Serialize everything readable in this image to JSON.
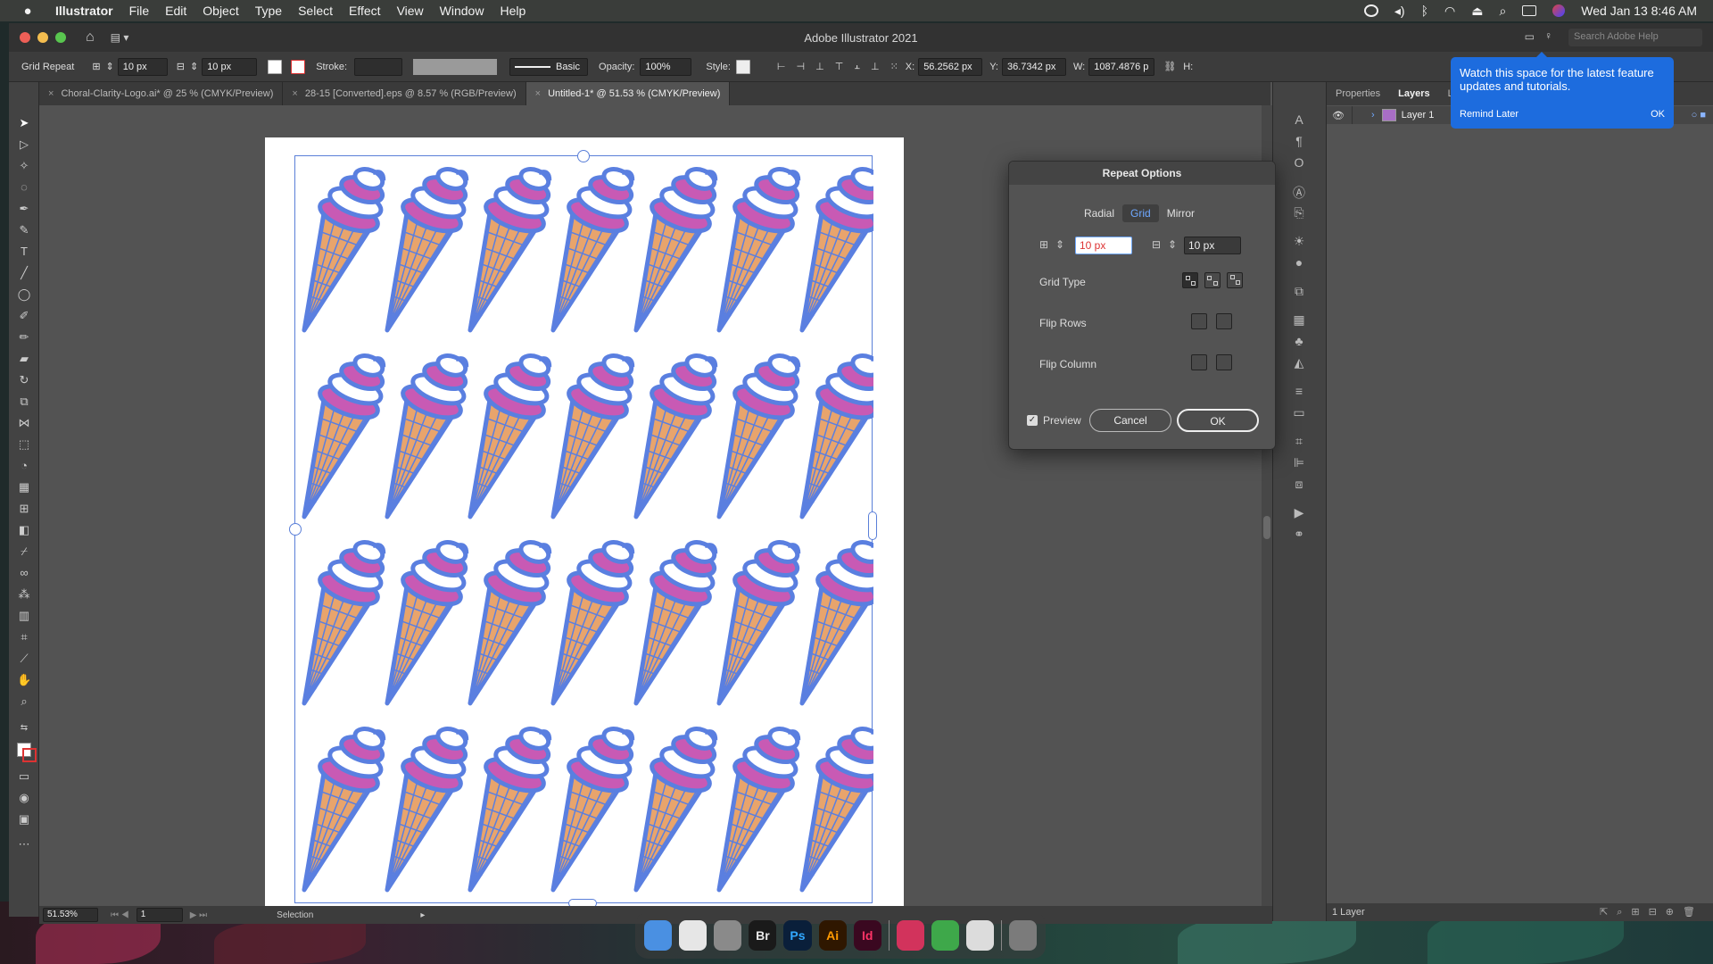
{
  "menubar": {
    "app_name": "Illustrator",
    "menus": [
      "File",
      "Edit",
      "Object",
      "Type",
      "Select",
      "Effect",
      "View",
      "Window",
      "Help"
    ],
    "clock": "Wed Jan 13  8:46 AM"
  },
  "window": {
    "title": "Adobe Illustrator 2021",
    "search_placeholder": "Search Adobe Help"
  },
  "control_bar": {
    "mode_label": "Grid Repeat",
    "h_spacing": "10 px",
    "v_spacing": "10 px",
    "stroke_label": "Stroke:",
    "brush_label": "Basic",
    "opacity_label": "Opacity:",
    "opacity_value": "100%",
    "style_label": "Style:",
    "x_label": "X:",
    "x_value": "56.2562 px",
    "y_label": "Y:",
    "y_value": "36.7342 px",
    "w_label": "W:",
    "w_value": "1087.4876 p",
    "h_label": "H:"
  },
  "tabs": [
    {
      "label": "Choral-Clarity-Logo.ai* @ 25 % (CMYK/Preview)",
      "active": false
    },
    {
      "label": "28-15 [Converted].eps @ 8.57 % (RGB/Preview)",
      "active": false
    },
    {
      "label": "Untitled-1* @ 51.53 % (CMYK/Preview)",
      "active": true
    }
  ],
  "status": {
    "zoom": "51.53%",
    "artboard": "1",
    "tool": "Selection"
  },
  "panel": {
    "tabs": [
      "Properties",
      "Layers",
      "Libr"
    ],
    "active_tab": "Layers",
    "layer_name": "Layer 1",
    "footer": "1 Layer"
  },
  "dialog": {
    "title": "Repeat Options",
    "modes": [
      "Radial",
      "Grid",
      "Mirror"
    ],
    "active_mode": "Grid",
    "h_spacing": "10 px",
    "v_spacing": "10 px",
    "grid_type_label": "Grid Type",
    "flip_rows_label": "Flip Rows",
    "flip_column_label": "Flip Column",
    "preview_label": "Preview",
    "preview_checked": true,
    "cancel_label": "Cancel",
    "ok_label": "OK"
  },
  "tooltip": {
    "message": "Watch this space for the latest feature updates and tutorials.",
    "remind_label": "Remind Later",
    "ok_label": "OK"
  },
  "pattern": {
    "rows": 4,
    "columns": 7
  },
  "dock": {
    "apps": [
      {
        "name": "finder-icon",
        "label": "",
        "color": "#4a90e2"
      },
      {
        "name": "chrome-icon",
        "label": "",
        "color": "#e6e6e6"
      },
      {
        "name": "system-preferences-icon",
        "label": "",
        "color": "#8a8a8a"
      },
      {
        "name": "bridge-icon",
        "label": "Br",
        "color": "#1a1a1a"
      },
      {
        "name": "photoshop-icon",
        "label": "Ps",
        "color": "#0a1f3a"
      },
      {
        "name": "illustrator-icon",
        "label": "Ai",
        "color": "#2f1700"
      },
      {
        "name": "indesign-icon",
        "label": "Id",
        "color": "#3a0820"
      },
      {
        "name": "creative-cloud-icon",
        "label": "",
        "color": "#d2335c"
      },
      {
        "name": "numbers-icon",
        "label": "",
        "color": "#3ea84a"
      },
      {
        "name": "preview-icon",
        "label": "",
        "color": "#dcdcdc"
      },
      {
        "name": "trash-icon",
        "label": "",
        "color": "#7b7b7b"
      }
    ]
  },
  "colors": {
    "accent": "#1d6cde",
    "selection": "#5a7fd8",
    "cone_blue": "#5a7fe0",
    "cone_pink": "#c85ab4",
    "cone_orange": "#e8a46c"
  }
}
